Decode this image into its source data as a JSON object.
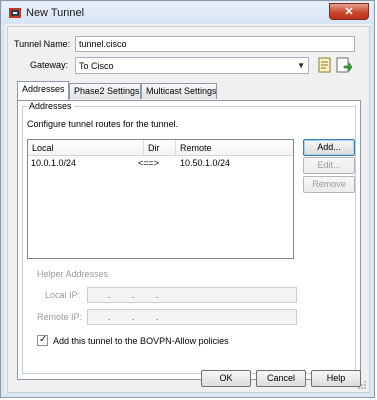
{
  "window": {
    "title": "New Tunnel",
    "close_label": "✕"
  },
  "form": {
    "tunnel_name_label": "Tunnel Name:",
    "tunnel_name_value": "tunnel.cisco",
    "gateway_label": "Gateway:",
    "gateway_value": "To Cisco"
  },
  "tabs": [
    {
      "label": "Addresses",
      "active": true
    },
    {
      "label": "Phase2 Settings",
      "active": false
    },
    {
      "label": "Multicast Settings",
      "active": false
    }
  ],
  "addresses": {
    "group_title": "Addresses",
    "description": "Configure tunnel routes for the tunnel.",
    "columns": [
      "Local",
      "Dir",
      "Remote"
    ],
    "rows": [
      {
        "local": "10.0.1.0/24",
        "dir": "<==>",
        "remote": "10.50.1.0/24"
      }
    ],
    "buttons": {
      "add": "Add...",
      "edit": "Edit...",
      "remove": "Remove"
    }
  },
  "helper": {
    "title": "Helper Addresses",
    "local_ip_label": "Local IP:",
    "remote_ip_label": "Remote IP:",
    "ip_dots": [
      ".",
      ".",
      "."
    ]
  },
  "bovpn_checkbox": {
    "label": "Add this tunnel to the BOVPN-Allow policies",
    "checked": true
  },
  "footer": {
    "ok": "OK",
    "cancel": "Cancel",
    "help": "Help"
  },
  "colors": {
    "accent": "#3c7fb1",
    "close_red": "#c9472f"
  }
}
